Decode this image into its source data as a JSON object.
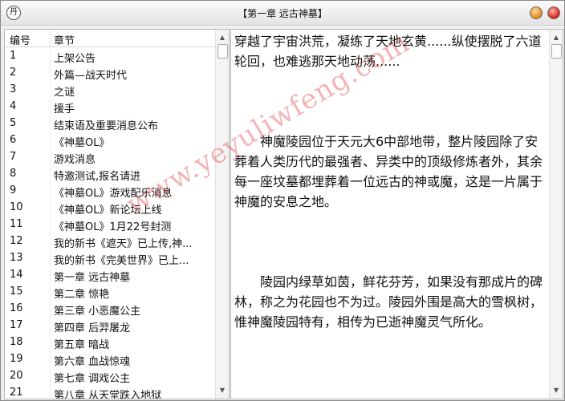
{
  "window": {
    "title": "【第一章 远古神墓】",
    "app_icon_glyph": "丹"
  },
  "chapter_list": {
    "columns": [
      "编号",
      "章节"
    ],
    "rows": [
      [
        "1",
        "上架公告"
      ],
      [
        "2",
        "外篇—战天时代"
      ],
      [
        "3",
        "之谜"
      ],
      [
        "4",
        "援手"
      ],
      [
        "5",
        "结束语及重要消息公布"
      ],
      [
        "6",
        "《神墓OL》"
      ],
      [
        "7",
        "游戏消息"
      ],
      [
        "8",
        "特邀测试,报名请进"
      ],
      [
        "9",
        "《神墓OL》游戏配乐消息"
      ],
      [
        "10",
        "《神墓OL》新论坛上线"
      ],
      [
        "11",
        "《神墓OL》1月22号封测"
      ],
      [
        "12",
        "我的新书《遮天》已上传,神..."
      ],
      [
        "13",
        "我的新书《完美世界》已上..."
      ],
      [
        "14",
        "第一章 远古神墓"
      ],
      [
        "15",
        "第二章 惊艳"
      ],
      [
        "16",
        "第三章 小恶魔公主"
      ],
      [
        "17",
        "第四章 后羿屠龙"
      ],
      [
        "18",
        "第五章 暗战"
      ],
      [
        "19",
        "第六章 血战惊魂"
      ],
      [
        "20",
        "第七章 调戏公主"
      ],
      [
        "21",
        "第八章 从天堂跌入地狱"
      ]
    ]
  },
  "content": {
    "paragraph_1": "穿越了宇宙洪荒，凝练了天地玄黄......纵使摆脱了六道轮回，也难逃那天地动荡......",
    "paragraph_2": "神魔陵园位于天元大6中部地带，整片陵园除了安葬着人类历代的最强者、异类中的顶级修炼者外，其余每一座坟墓都埋葬着一位远古的神或魔，这是一片属于神魔的安息之地。",
    "paragraph_3": "陵园内绿草如茵，鲜花芬芳，如果没有那成片的碑林，称之为花园也不为过。陵园外围是高大的雪枫树，惟神魔陵园特有，相传为已逝神魔灵气所化。"
  },
  "watermark": "www.yeyuliwfeng.com",
  "colors": {
    "minimize": "#e08a1a",
    "close": "#d21f12",
    "watermark": "#dc2828"
  }
}
